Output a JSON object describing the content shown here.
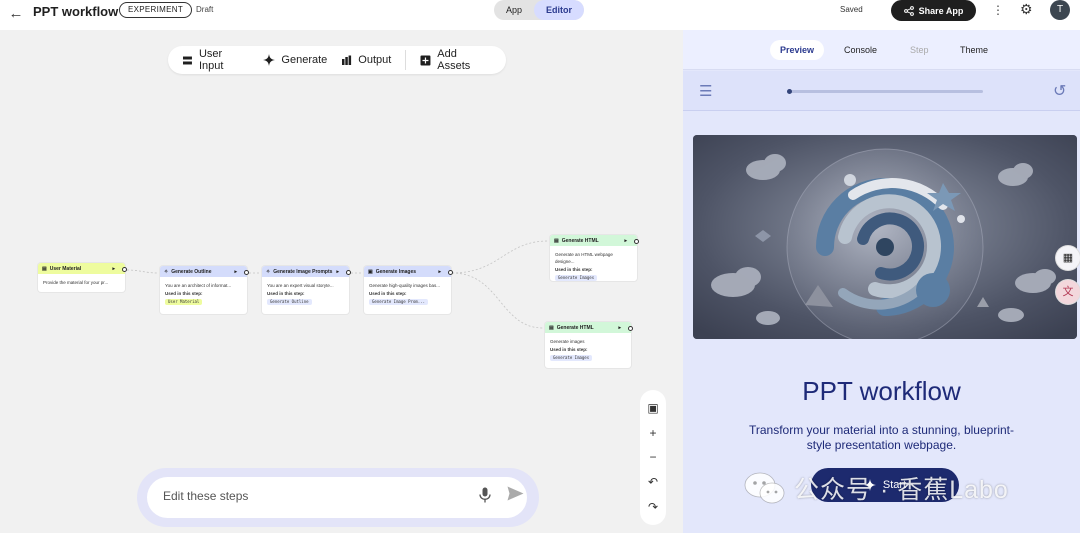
{
  "topbar": {
    "title": "PPT workflow",
    "badge": "EXPERIMENT",
    "status": "Draft",
    "modes": [
      "App",
      "Editor"
    ],
    "active_mode": "Editor",
    "saved": "Saved",
    "share_label": "Share App",
    "avatar_initial": "T"
  },
  "toolbar": {
    "items": [
      {
        "label": "User Input",
        "icon": "input-icon"
      },
      {
        "label": "Generate",
        "icon": "sparkle-icon"
      },
      {
        "label": "Output",
        "icon": "output-icon"
      },
      {
        "label": "Add Assets",
        "icon": "add-box-icon"
      }
    ]
  },
  "nodes": {
    "user_material": {
      "title": "User Material",
      "desc": "Provide the material for your pr..."
    },
    "generate_outline": {
      "title": "Generate Outline",
      "desc": "You are an architect of informat...",
      "used": "Used in this step:",
      "chip": "User Material"
    },
    "generate_image_prompts": {
      "title": "Generate Image Prompts",
      "desc": "You are an expert visual storyte...",
      "used": "Used in this step:",
      "chip": "Generate Outline"
    },
    "generate_images": {
      "title": "Generate Images",
      "desc": "Generate high-quality images bas...",
      "used": "Used in this step:",
      "chip": "Generate Image Prom..."
    },
    "generate_html_1": {
      "title": "Generate HTML",
      "desc": "Generate an HTML webpage designe...",
      "used": "Used in this step:",
      "chip": "Generate Images"
    },
    "generate_html_2": {
      "title": "Generate HTML",
      "desc": "Generate images",
      "used": "Used in this step:",
      "chip": "Generate Images"
    }
  },
  "editor": {
    "placeholder": "Edit these steps"
  },
  "panel": {
    "tabs": [
      "Preview",
      "Console",
      "Step",
      "Theme"
    ],
    "active_tab": "Preview",
    "disabled_tab": "Step",
    "progress": 0.02,
    "app_title": "PPT workflow",
    "app_subtitle": "Transform your material into a stunning, blueprint-style presentation webpage.",
    "start_label": "Start"
  },
  "watermark": {
    "text": "公众号 · 香蕉Labo"
  },
  "colors": {
    "accent": "#2b3a8f",
    "panel_bg": "#e3e7fb",
    "start_button": "#1d2a6e"
  }
}
